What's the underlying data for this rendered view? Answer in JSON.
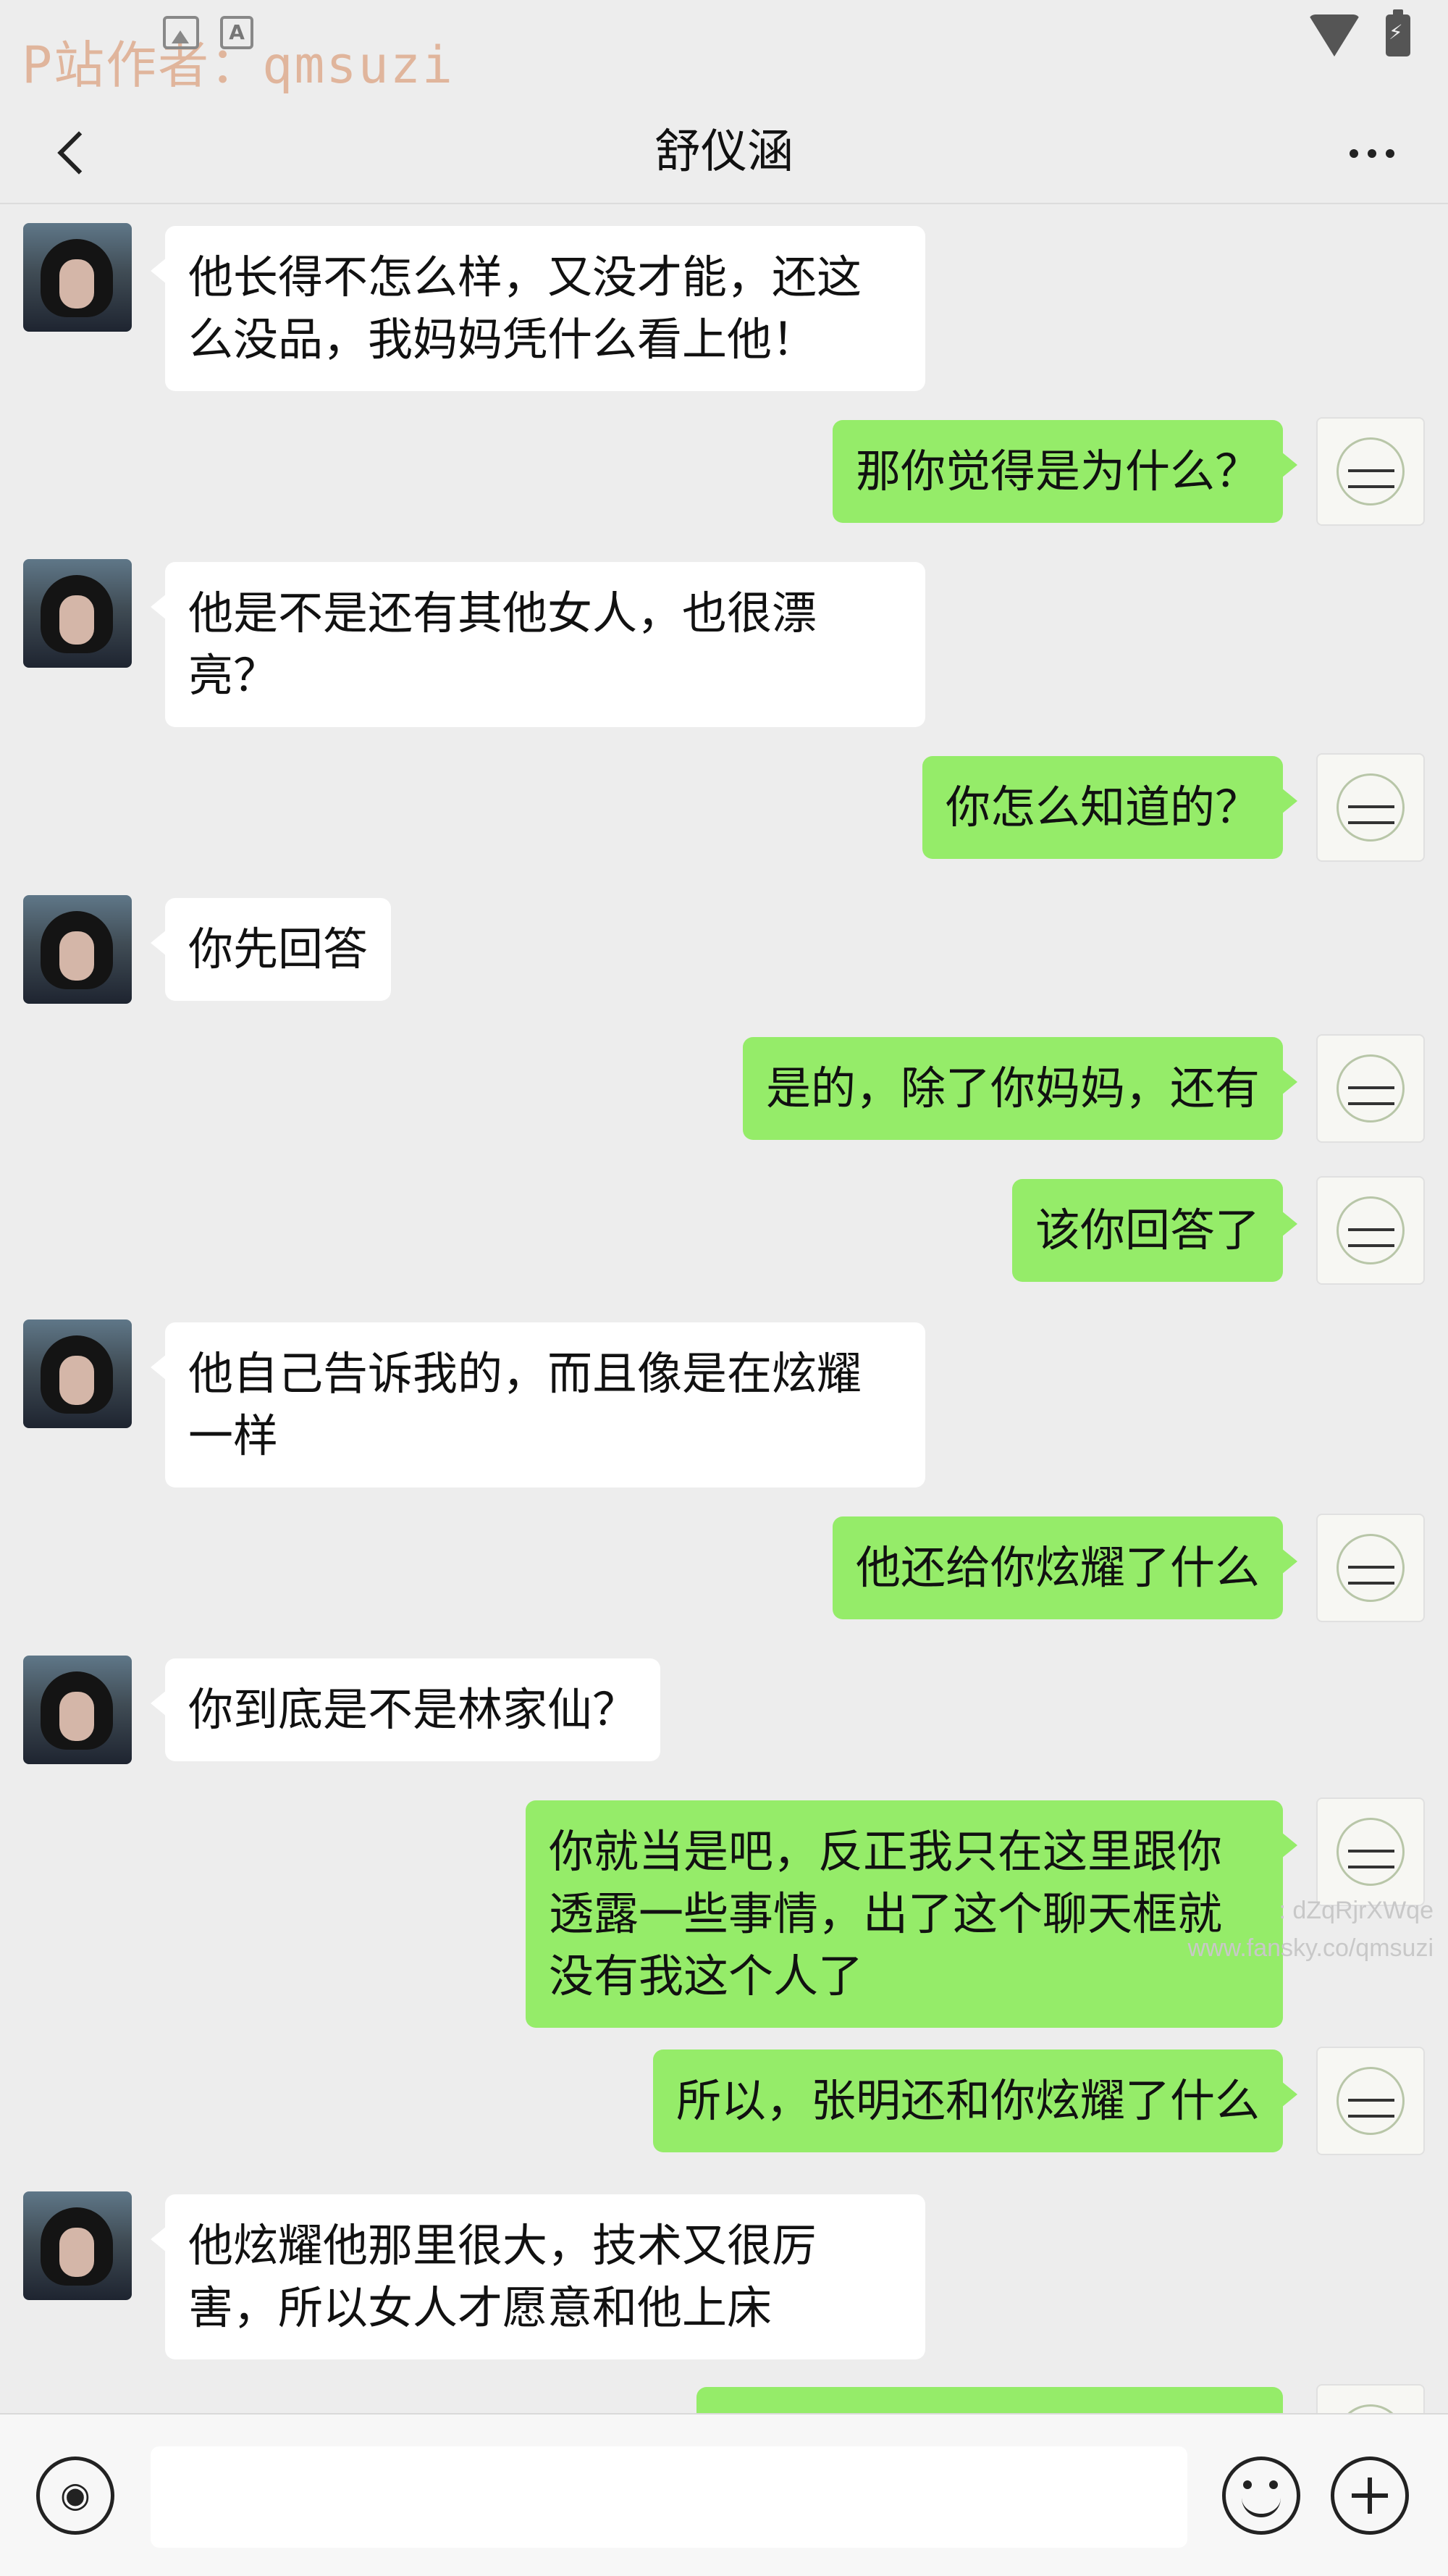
{
  "status_bar": {
    "watermark": "P站作者：qmsuzi",
    "icons": [
      "image-notification-icon",
      "a-notification-icon",
      "wifi-icon",
      "battery-charging-icon"
    ]
  },
  "header": {
    "title": "舒仪涵",
    "back_icon": "chevron-left-icon",
    "more_icon": "more-dots-icon"
  },
  "messages": [
    {
      "side": "left",
      "text": "他长得不怎么样，又没才能，还这么没品，我妈妈凭什么看上他！"
    },
    {
      "side": "right",
      "text": "那你觉得是为什么？"
    },
    {
      "side": "left",
      "text": "他是不是还有其他女人，也很漂亮？"
    },
    {
      "side": "right",
      "text": "你怎么知道的？"
    },
    {
      "side": "left",
      "text": "你先回答"
    },
    {
      "side": "right",
      "text": "是的，除了你妈妈，还有"
    },
    {
      "side": "right",
      "text": "该你回答了"
    },
    {
      "side": "left",
      "text": "他自己告诉我的，而且像是在炫耀一样"
    },
    {
      "side": "right",
      "text": "他还给你炫耀了什么"
    },
    {
      "side": "left",
      "text": "你到底是不是林家仙？"
    },
    {
      "side": "right",
      "text": "你就当是吧，反正我只在这里跟你透露一些事情，出了这个聊天框就没有我这个人了"
    },
    {
      "side": "right",
      "text": "所以，张明还和你炫耀了什么"
    },
    {
      "side": "left",
      "text": "他炫耀他那里很大，技术又很厉害，所以女人才愿意和他上床"
    },
    {
      "side": "right",
      "text": ""
    }
  ],
  "overlay_watermark": {
    "line1": ": dZqRjrXWqe",
    "line2": "www.fansky.co/qmsuzi"
  },
  "input_bar": {
    "text_value": "",
    "voice_icon": "voice-icon",
    "emoji_icon": "emoji-icon",
    "plus_icon": "plus-icon"
  },
  "colors": {
    "background": "#ededed",
    "received_bubble": "#ffffff",
    "sent_bubble": "#95ec69",
    "watermark": "#e0b59c"
  }
}
